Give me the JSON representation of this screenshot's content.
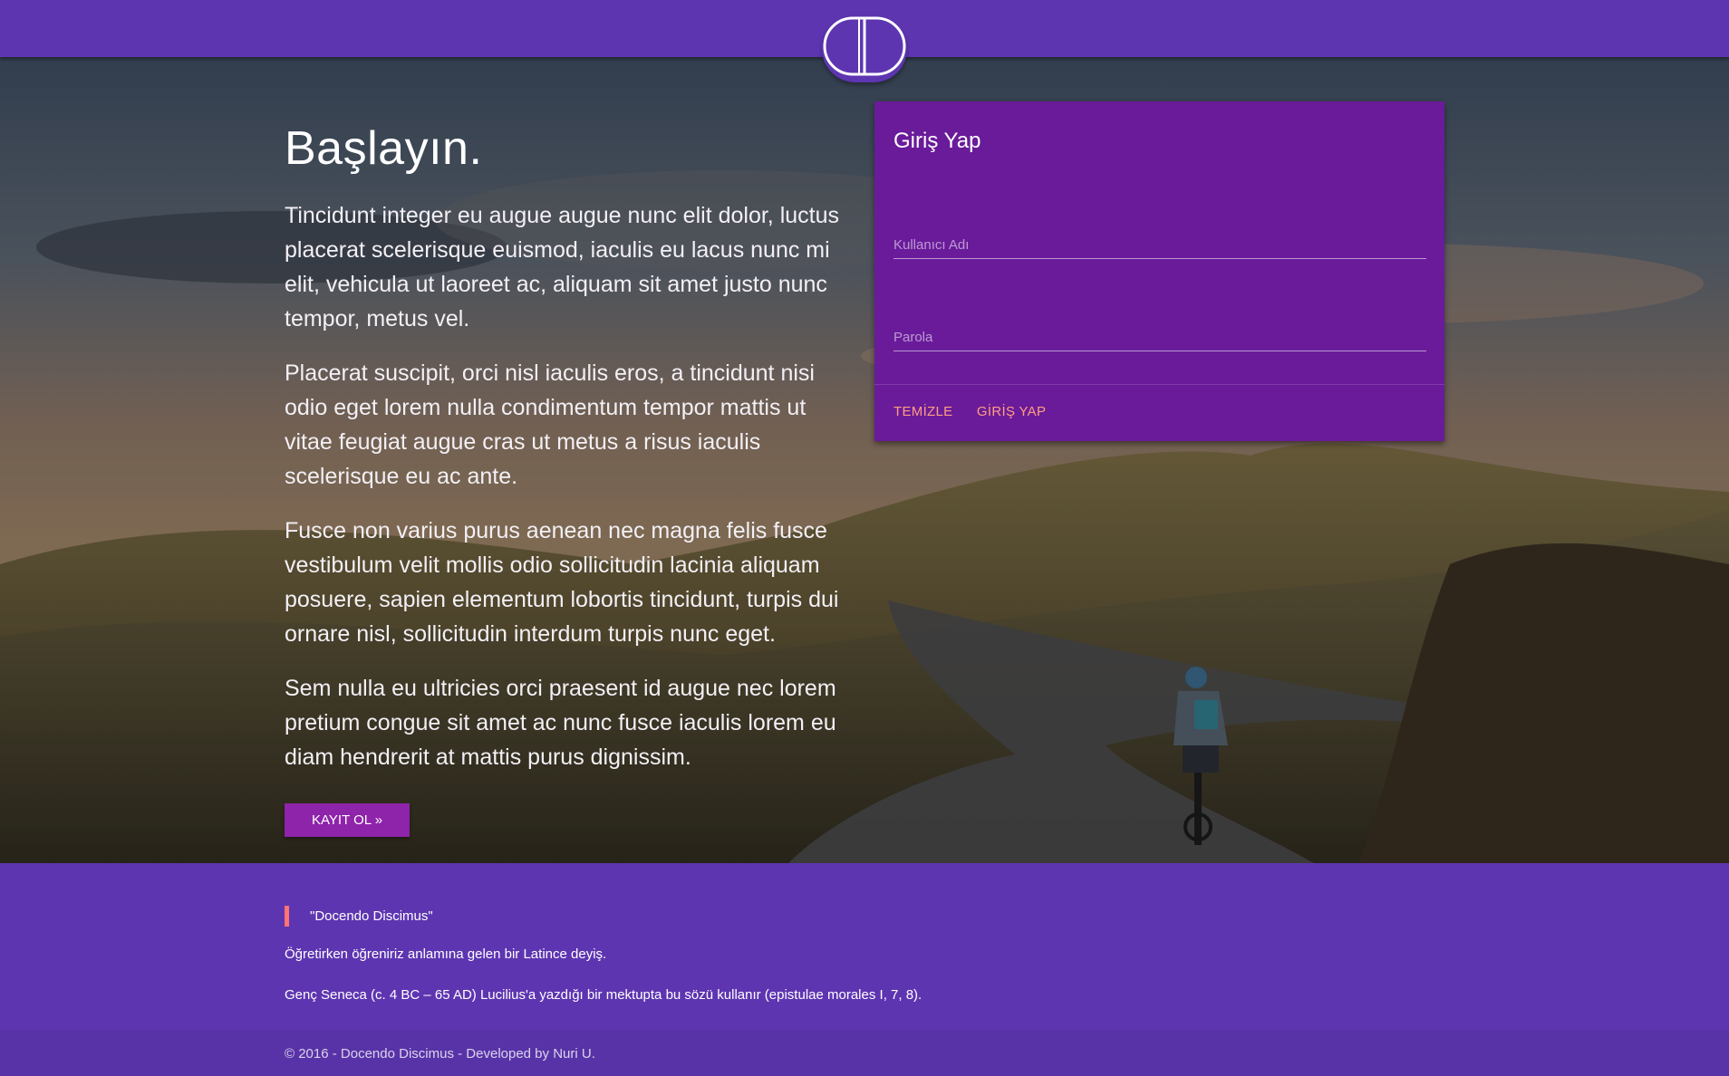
{
  "header": {
    "logo_icon": "brand-logo-icon",
    "bar_color": "#5e35b1"
  },
  "hero": {
    "headline": "Başlayın.",
    "paragraphs": [
      "Tincidunt integer eu augue augue nunc elit dolor, luctus placerat scelerisque euismod, iaculis eu lacus nunc mi elit, vehicula ut laoreet ac, aliquam sit amet justo nunc tempor, metus vel.",
      "Placerat suscipit, orci nisl iaculis eros, a tincidunt nisi odio eget lorem nulla condimentum tempor mattis ut vitae feugiat augue cras ut metus a risus iaculis scelerisque eu ac ante.",
      "Fusce non varius purus aenean nec magna felis fusce vestibulum velit mollis odio sollicitudin lacinia aliquam posuere, sapien elementum lobortis tincidunt, turpis dui ornare nisl, sollicitudin interdum turpis nunc eget.",
      "Sem nulla eu ultricies orci praesent id augue nec lorem pretium congue sit amet ac nunc fusce iaculis lorem eu diam hendrerit at mattis purus dignissim."
    ],
    "cta_label": "KAYIT OL »",
    "cta_color": "#8e24aa"
  },
  "login": {
    "title": "Giriş Yap",
    "username_placeholder": "Kullanıcı Adı",
    "username_value": "",
    "password_placeholder": "Parola",
    "password_value": "",
    "clear_label": "TEMİZLE",
    "submit_label": "GİRİŞ YAP",
    "card_color": "#6a1b9a",
    "action_color": "#ff9e80"
  },
  "footer": {
    "quote": "\"Docendo Discimus\"",
    "quote_accent": "#ff7373",
    "meaning": "Öğretirken öğreniriz anlamına gelen bir Latince deyiş.",
    "source": "Genç Seneca (c. 4 BC – 65 AD) Lucilius'a yazdığı bir mektupta bu sözü kullanır (epistulae morales I, 7, 8).",
    "copyright": "© 2016 - Docendo Discimus - Developed by Nuri U."
  }
}
